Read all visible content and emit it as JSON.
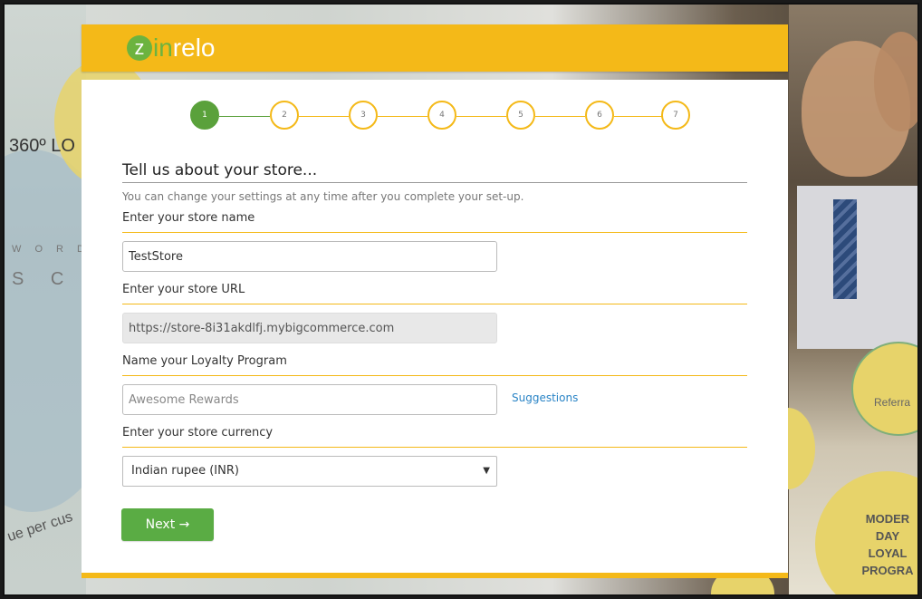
{
  "background": {
    "text_360": "360º LO",
    "text_word": "W O R D",
    "text_sca": "S C A",
    "text_percus": "ue per cus",
    "referral": "Referra",
    "modern": [
      "MODER",
      "DAY",
      "LOYAL",
      "PROGRA"
    ]
  },
  "header": {
    "logo_z": "z",
    "logo_in": "in",
    "logo_relo": "relo",
    "brand_color": "#f4b918",
    "logo_green": "#6cb33f"
  },
  "stepper": {
    "steps": [
      "1",
      "2",
      "3",
      "4",
      "5",
      "6",
      "7"
    ],
    "active_step": 1,
    "active_color": "#5aa13b"
  },
  "form": {
    "title": "Tell us about your store...",
    "subtitle": "You can change your settings at any time after you complete your set-up.",
    "store_name_label": "Enter your store name",
    "store_name_value": "TestStore",
    "store_url_label": "Enter your store URL",
    "store_url_value": "https://store-8i31akdlfj.mybigcommerce.com",
    "program_label": "Name your Loyalty Program",
    "program_placeholder": "Awesome Rewards",
    "suggestions_link": "Suggestions",
    "currency_label": "Enter your store currency",
    "currency_value": "Indian rupee (INR)",
    "next_button": "Next →"
  }
}
